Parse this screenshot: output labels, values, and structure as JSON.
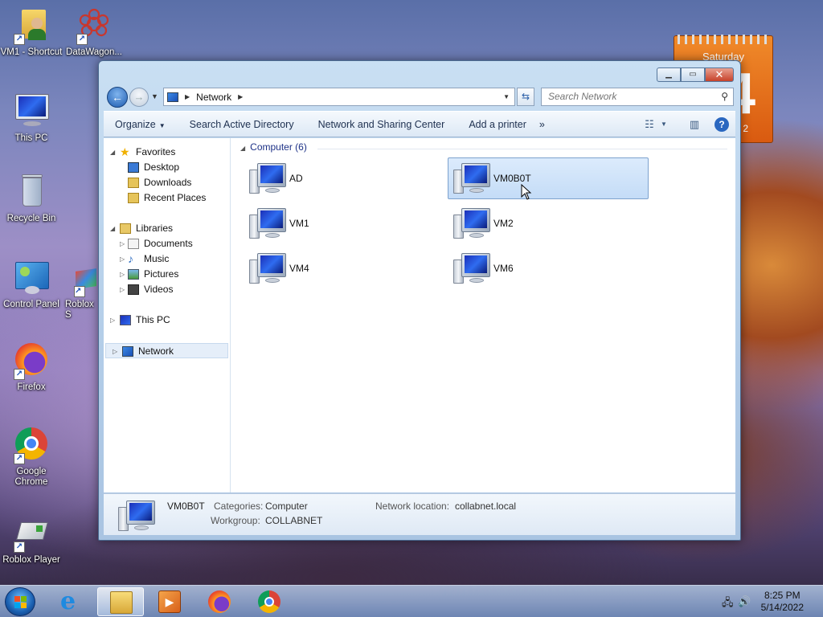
{
  "desktop": {
    "icons": [
      {
        "label": "VM1 - Shortcut"
      },
      {
        "label": "DataWagon..."
      },
      {
        "label": "This PC"
      },
      {
        "label": "Recycle Bin"
      },
      {
        "label": "Control Panel"
      },
      {
        "label": "Roblox S"
      },
      {
        "label": "Firefox"
      },
      {
        "label": "Google Chrome"
      },
      {
        "label": "Roblox Player"
      }
    ]
  },
  "gadget": {
    "day_name": "Saturday",
    "day_num": "14",
    "year_frag": "2"
  },
  "window": {
    "address": {
      "crumb": "Network"
    },
    "search": {
      "placeholder": "Search Network"
    },
    "toolbar": {
      "organize": "Organize",
      "search_ad": "Search Active Directory",
      "network_center": "Network and Sharing Center",
      "add_printer": "Add a printer",
      "more": "»"
    },
    "nav": {
      "favorites": "Favorites",
      "desktop": "Desktop",
      "downloads": "Downloads",
      "recent": "Recent Places",
      "libraries": "Libraries",
      "documents": "Documents",
      "music": "Music",
      "pictures": "Pictures",
      "videos": "Videos",
      "this_pc": "This PC",
      "network": "Network"
    },
    "group": {
      "label": "Computer (6)"
    },
    "items": [
      {
        "label": "AD"
      },
      {
        "label": "VM0B0T"
      },
      {
        "label": "VM1"
      },
      {
        "label": "VM2"
      },
      {
        "label": "VM4"
      },
      {
        "label": "VM6"
      }
    ],
    "details": {
      "name": "VM0B0T",
      "categories_key": "Categories:",
      "categories_val": "Computer",
      "workgroup_key": "Workgroup:",
      "workgroup_val": "COLLABNET",
      "netloc_key": "Network location:",
      "netloc_val": "collabnet.local"
    }
  },
  "taskbar": {
    "time": "8:25 PM",
    "date": "5/14/2022"
  },
  "colors": {
    "accent": "#1e5cb0",
    "selection": "#c4dcf7",
    "gadget": "#e06a18"
  }
}
